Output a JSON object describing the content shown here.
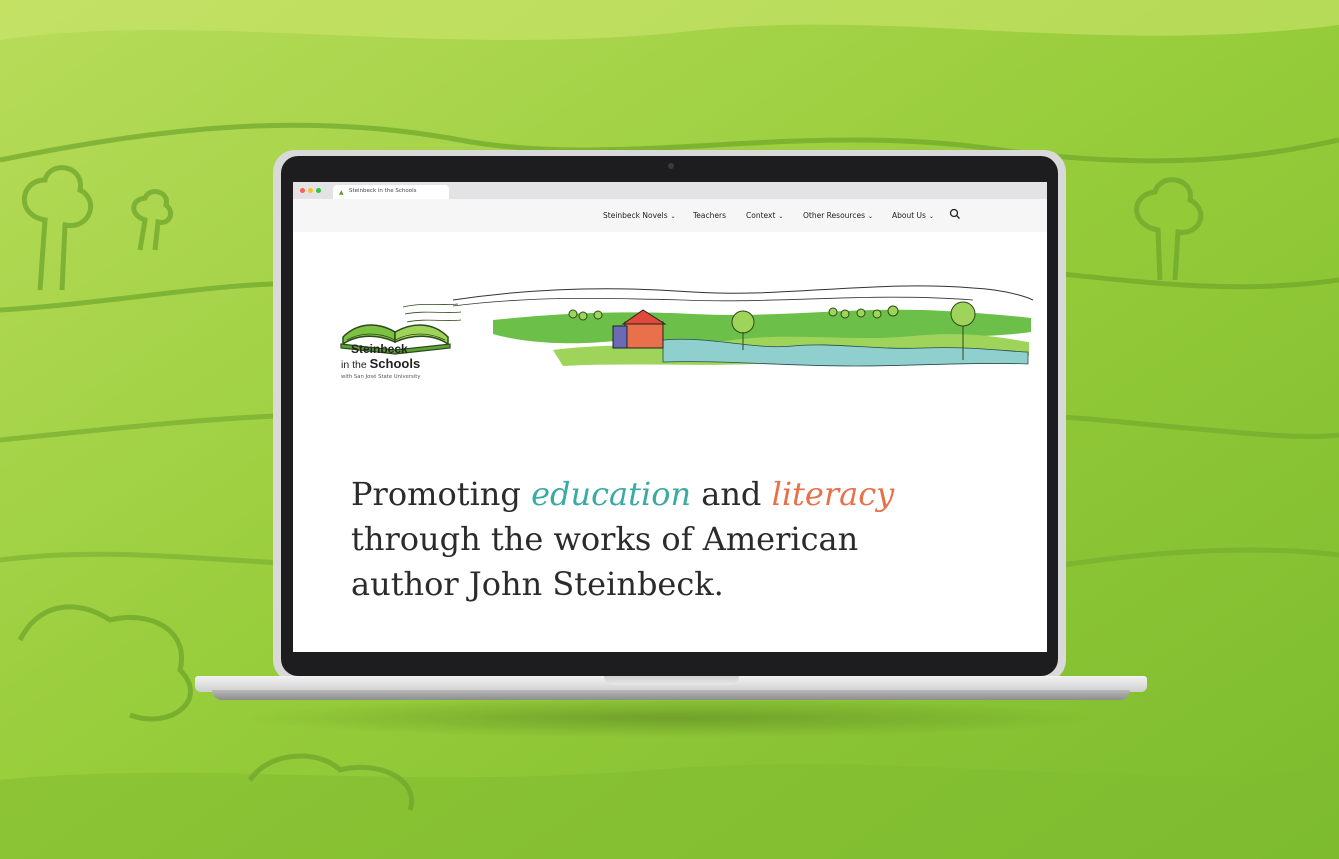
{
  "browser": {
    "tab_title": "Steinbeck in the Schools"
  },
  "nav": {
    "items": [
      {
        "label": "Steinbeck Novels",
        "has_dropdown": true
      },
      {
        "label": "Teachers",
        "has_dropdown": false
      },
      {
        "label": "Context",
        "has_dropdown": true
      },
      {
        "label": "Other Resources",
        "has_dropdown": true
      },
      {
        "label": "About Us",
        "has_dropdown": true
      }
    ],
    "chevron": "⌄",
    "search_icon": "search-icon"
  },
  "logo": {
    "line1": "Steinbeck",
    "line2_prefix": "in the",
    "line2_bold": "Schools",
    "sub": "with San José State University"
  },
  "hero": {
    "part1": "Promoting ",
    "accent1": "education",
    "part2": " and ",
    "accent2": "literacy",
    "line2": "through the works of American",
    "line3": "author John Steinbeck."
  },
  "colors": {
    "accent_teal": "#3aaba2",
    "accent_orange": "#e8704a",
    "background_green": "#a9d84f"
  }
}
